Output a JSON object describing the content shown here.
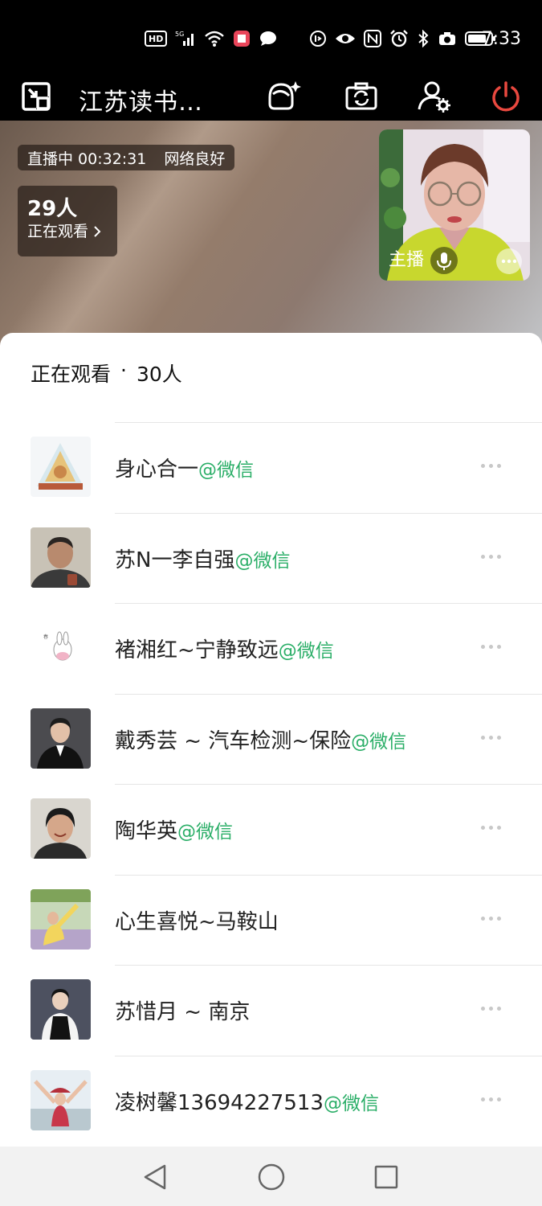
{
  "status_bar": {
    "time": "7:33",
    "hd_label": "HD",
    "network_label": "5G",
    "icons": [
      "hd-icon",
      "signal-icon",
      "wifi-icon",
      "book-app-icon",
      "chat-bubble-icon",
      "nfc-clock-icon",
      "eye-icon",
      "nfc-icon",
      "alarm-icon",
      "bluetooth-icon",
      "camera-icon",
      "battery-icon"
    ]
  },
  "top_bar": {
    "title": "江苏读书…",
    "buttons": [
      "minimize-window-icon",
      "beauty-filter-icon",
      "switch-camera-icon",
      "guest-settings-icon",
      "power-icon"
    ],
    "power_color": "#e8483f"
  },
  "live": {
    "status": "直播中 00:32:31",
    "network": "网络良好",
    "viewer_count": "29人",
    "viewer_label": "正在观看",
    "host_label": "主播"
  },
  "sheet": {
    "title": "正在观看",
    "separator": "·",
    "count": "30人"
  },
  "viewers": [
    {
      "name": "身心合一",
      "tag": "@微信"
    },
    {
      "name": "苏N一李自强",
      "tag": "@微信"
    },
    {
      "name": "褚湘红~宁静致远",
      "tag": "@微信"
    },
    {
      "name": "戴秀芸 ~ 汽车检测~保险",
      "tag": "@微信"
    },
    {
      "name": "陶华英",
      "tag": "@微信"
    },
    {
      "name": "心生喜悦~马鞍山",
      "tag": ""
    },
    {
      "name": "苏惜月 ~ 南京",
      "tag": ""
    },
    {
      "name": "凌树馨13694227513",
      "tag": "@微信"
    }
  ],
  "colors": {
    "wechat_green": "#2aae67",
    "power_red": "#e8483f"
  }
}
